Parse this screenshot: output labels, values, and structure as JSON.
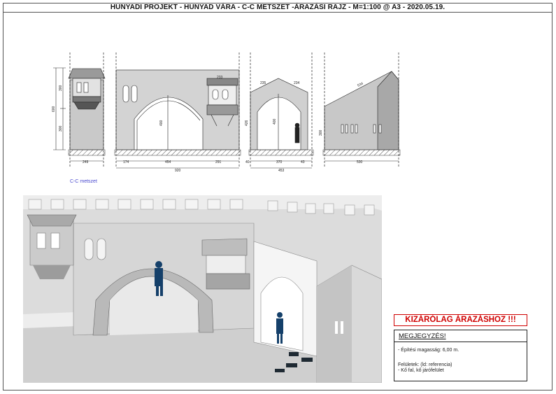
{
  "title": "HUNYADI PROJEKT  - HUNYAD VÁRA   - C-C METSZET -ÁRAZÁSI RAJZ - M=1:100 @ A3 - 2020.05.19.",
  "section_caption": "C-C metszet",
  "warning": "KIZÁRÓLAG ÁRAZÁSHOZ !!!",
  "note": {
    "heading": "MEGJEGYZÉS!",
    "line1": "- Építési magasság:  6,00 m.",
    "line2": "Felületek: (ld: referencia)",
    "line3": "- Kő fal, kő járófelület"
  },
  "dims": {
    "h600": "600",
    "h300a": "300",
    "h300b": "300",
    "w249": "249",
    "w174": "174",
    "w454": "454",
    "w291": "291",
    "w920": "920",
    "h400": "400",
    "w40": "40",
    "w370": "370",
    "w43": "43",
    "w453": "453",
    "h426": "426",
    "w235": "235",
    "w234": "234",
    "w530": "530",
    "w534": "534",
    "h300c": "300",
    "w233": "233"
  }
}
